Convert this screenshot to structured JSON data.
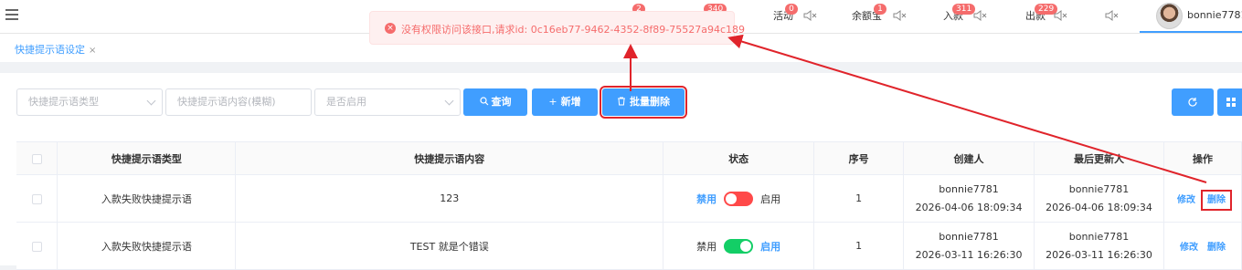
{
  "topbar": {
    "nav": [
      {
        "label": "",
        "badge": "2"
      },
      {
        "label": "",
        "badge": "340"
      },
      {
        "label": "活动",
        "badge": "0"
      },
      {
        "label": "余额宝",
        "badge": "1"
      },
      {
        "label": "入款",
        "badge": "311"
      },
      {
        "label": "出款",
        "badge": "229"
      }
    ],
    "username": "bonnie7781"
  },
  "tabs": [
    {
      "label": "快捷提示语设定",
      "close": "×"
    }
  ],
  "toast": {
    "icon": "×",
    "message": "没有权限访问该接口,请求id: 0c16eb77-9462-4352-8f89-75527a94c189"
  },
  "filters": {
    "type_placeholder": "快捷提示语类型",
    "content_placeholder": "快捷提示语内容(模糊)",
    "enabled_placeholder": "是否启用"
  },
  "buttons": {
    "query": "查询",
    "add": "新增",
    "batch_delete": "批量删除"
  },
  "table": {
    "headers": [
      "快捷提示语类型",
      "快捷提示语内容",
      "状态",
      "序号",
      "创建人",
      "最后更新人",
      "操作"
    ],
    "status_labels": {
      "disable": "禁用",
      "enable": "启用"
    },
    "actions": {
      "edit": "修改",
      "delete": "删除"
    },
    "rows": [
      {
        "type": "入款失败快捷提示语",
        "content": "123",
        "enabled": false,
        "order": "1",
        "creator": "bonnie7781",
        "created_at": "2026-04-06 18:09:34",
        "updater": "bonnie7781",
        "updated_at": "2026-04-06 18:09:34"
      },
      {
        "type": "入款失败快捷提示语",
        "content": "TEST 就是个错误",
        "enabled": true,
        "order": "1",
        "creator": "bonnie7781",
        "created_at": "2026-03-11 16:26:30",
        "updater": "bonnie7781",
        "updated_at": "2026-03-11 16:26:30"
      }
    ]
  },
  "colors": {
    "accent": "#409eff",
    "danger": "#f56c6c",
    "annotation": "#e0242b"
  }
}
